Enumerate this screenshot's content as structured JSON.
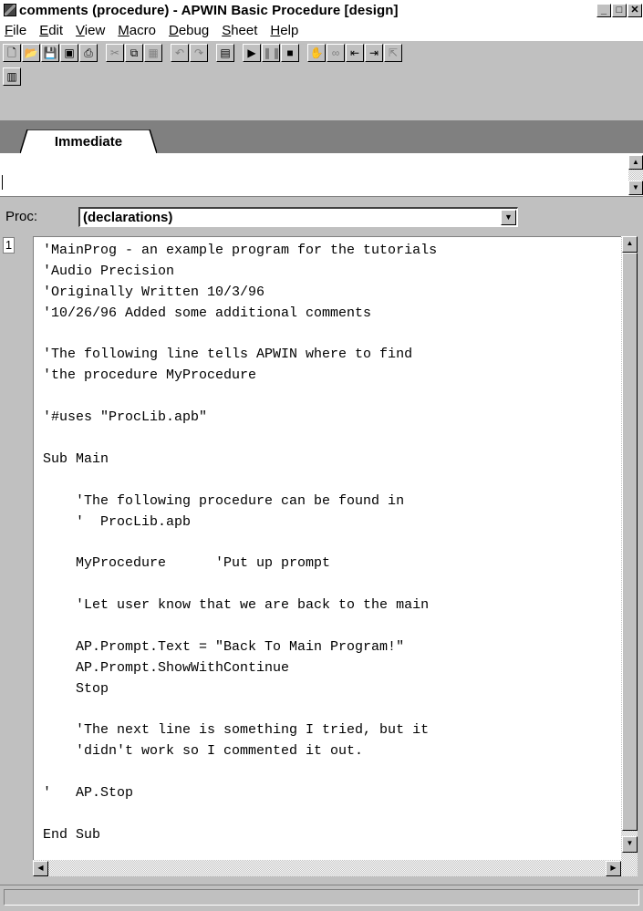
{
  "window": {
    "title": "comments (procedure) - APWIN Basic Procedure [design]",
    "minimize_glyph": "_",
    "maximize_glyph": "□",
    "close_glyph": "✕"
  },
  "menu": [
    "File",
    "Edit",
    "View",
    "Macro",
    "Debug",
    "Sheet",
    "Help"
  ],
  "menu_underline": [
    "F",
    "E",
    "V",
    "M",
    "D",
    "S",
    "H"
  ],
  "toolbar": {
    "row1": [
      {
        "name": "new-icon",
        "glyph": "🗋",
        "enabled": true
      },
      {
        "name": "open-icon",
        "glyph": "📂",
        "enabled": true
      },
      {
        "name": "save-icon",
        "glyph": "💾",
        "enabled": true
      },
      {
        "name": "save-all-icon",
        "glyph": "▣",
        "enabled": true
      },
      {
        "name": "print-icon",
        "glyph": "⎙",
        "enabled": true
      },
      {
        "name": "cut-icon",
        "glyph": "✂",
        "enabled": false
      },
      {
        "name": "copy-icon",
        "glyph": "⧉",
        "enabled": true
      },
      {
        "name": "paste-icon",
        "glyph": "▦",
        "enabled": false
      },
      {
        "name": "undo-icon",
        "glyph": "↶",
        "enabled": false
      },
      {
        "name": "redo-icon",
        "glyph": "↷",
        "enabled": false
      },
      {
        "name": "dialog-editor-icon",
        "glyph": "▤",
        "enabled": true
      },
      {
        "name": "run-icon",
        "glyph": "▶",
        "enabled": true
      },
      {
        "name": "pause-icon",
        "glyph": "❚❚",
        "enabled": false
      },
      {
        "name": "stop-icon",
        "glyph": "■",
        "enabled": true
      },
      {
        "name": "breakpoint-hand-icon",
        "glyph": "✋",
        "enabled": true
      },
      {
        "name": "watch-icon",
        "glyph": "∞",
        "enabled": false
      },
      {
        "name": "step-into-icon",
        "glyph": "⇤",
        "enabled": true
      },
      {
        "name": "step-over-icon",
        "glyph": "⇥",
        "enabled": true
      },
      {
        "name": "step-out-icon",
        "glyph": "⇱",
        "enabled": false
      }
    ],
    "row2": [
      {
        "name": "procedure-list-icon",
        "glyph": "▥",
        "enabled": true
      }
    ]
  },
  "tab_label": "Immediate",
  "proc": {
    "label": "Proc:",
    "value": "(declarations)"
  },
  "line_number": "1",
  "code": [
    "'MainProg - an example program for the tutorials",
    "'Audio Precision",
    "'Originally Written 10/3/96",
    "'10/26/96 Added some additional comments",
    "",
    "'The following line tells APWIN where to find",
    "'the procedure MyProcedure",
    "",
    "'#uses \"ProcLib.apb\"",
    "",
    "Sub Main",
    "",
    "    'The following procedure can be found in",
    "    '  ProcLib.apb",
    "",
    "    MyProcedure      'Put up prompt",
    "",
    "    'Let user know that we are back to the main",
    "",
    "    AP.Prompt.Text = \"Back To Main Program!\"",
    "    AP.Prompt.ShowWithContinue",
    "    Stop",
    "",
    "    'The next line is something I tried, but it",
    "    'didn't work so I commented it out.",
    "",
    "'   AP.Stop",
    "",
    "End Sub"
  ]
}
